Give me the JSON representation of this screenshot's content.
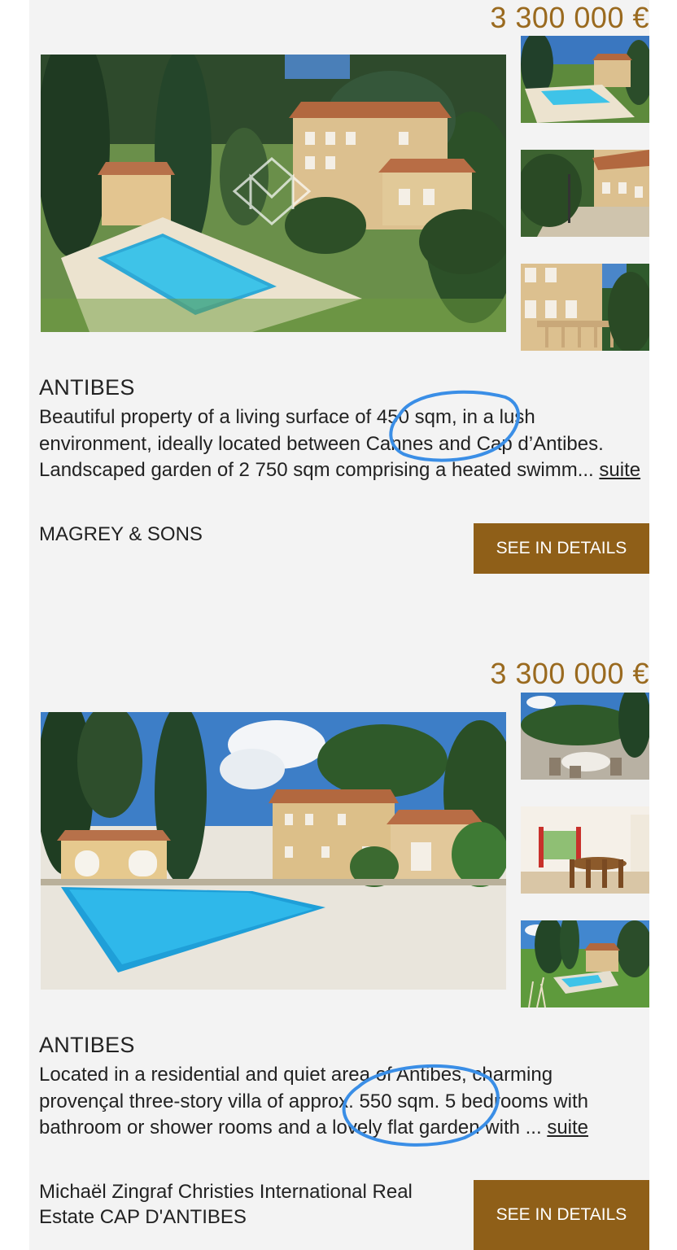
{
  "listings": [
    {
      "price": "3 300 000 €",
      "location": "ANTIBES",
      "description": "Beautiful property of a living surface of 450 sqm, in a lush environment, ideally located between Cannes and Cap d’Antibes. Landscaped garden of 2 750 sqm comprising a heated swimm... ",
      "more_label": "suite",
      "agency": "MAGREY & SONS",
      "button_label": "SEE IN DETAILS"
    },
    {
      "price": "3 300 000 €",
      "location": "ANTIBES",
      "description": "Located in a residential and quiet area of Antibes, charming provençal three-story villa of approx. 550 sqm. 5 bedrooms with bathroom or shower rooms and a lovely flat garden with ... ",
      "more_label": "suite",
      "agency": "Michaël Zingraf Christies International Real Estate CAP D'ANTIBES",
      "button_label": "SEE IN DETAILS"
    }
  ],
  "colors": {
    "accent": "#8f5f18",
    "price": "#9a6a1f",
    "annotation": "#3a8ee6",
    "background": "#f3f3f3"
  },
  "icons": [
    "watermark-logo-icon"
  ]
}
